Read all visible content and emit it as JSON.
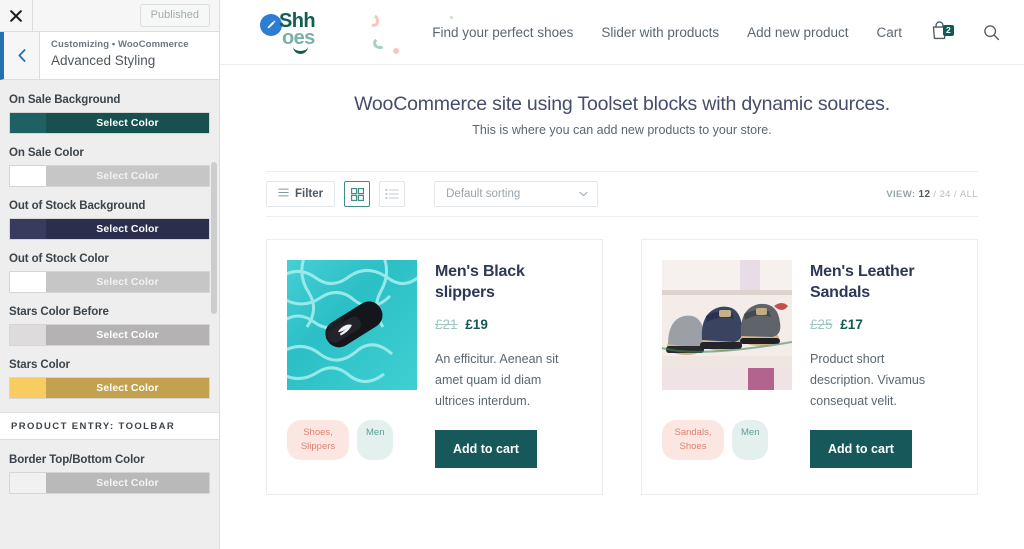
{
  "customizer": {
    "close_icon": "close-icon",
    "published_label": "Published",
    "back_icon": "chevron-left-icon",
    "breadcrumb": "Customizing • WooCommerce",
    "panel_title": "Advanced Styling",
    "controls": [
      {
        "label": "On Sale Background",
        "button_label": "Select Color",
        "chip_color": "#1e6063",
        "button_color": "#16504f",
        "button_text_color": "#ffffff"
      },
      {
        "label": "On Sale Color",
        "button_label": "Select Color",
        "chip_color": "#ffffff",
        "button_color": "#c6c6c6",
        "button_text_color": "#f2f2f2"
      },
      {
        "label": "Out of Stock Background",
        "button_label": "Select Color",
        "chip_color": "#373c5e",
        "button_color": "#2b2e4d",
        "button_text_color": "#ffffff"
      },
      {
        "label": "Out of Stock Color",
        "button_label": "Select Color",
        "chip_color": "#ffffff",
        "button_color": "#c6c6c6",
        "button_text_color": "#f2f2f2"
      },
      {
        "label": "Stars Color Before",
        "button_label": "Select Color",
        "chip_color": "#dddbdb",
        "button_color": "#b4b2b2",
        "button_text_color": "#ffffff"
      },
      {
        "label": "Stars Color",
        "button_label": "Select Color",
        "chip_color": "#f8cc61",
        "button_color": "#c3a14e",
        "button_text_color": "#ffffff"
      }
    ],
    "section_heading": "PRODUCT ENTRY: TOOLBAR",
    "controls_after": [
      {
        "label": "Border Top/Bottom Color",
        "button_label": "Select Color",
        "chip_color": "#f1f1f1",
        "button_color": "#b9b9b9",
        "button_text_color": "#f4f4f4"
      }
    ]
  },
  "site": {
    "logo": {
      "mark_icon": "pencil-circle-icon",
      "text_top": "Shh",
      "text_bottom": "oes"
    },
    "nav": [
      {
        "label": "Find your perfect shoes"
      },
      {
        "label": "Slider with products"
      },
      {
        "label": "Add new product"
      },
      {
        "label": "Cart"
      }
    ],
    "cart": {
      "icon": "shopping-bag-icon",
      "count": "2",
      "badge_color": "#0f5c56"
    },
    "search_icon": "search-icon",
    "page_title": "WooCommerce site using Toolset blocks with dynamic sources.",
    "page_subtitle": "This is where you can add new products to your store."
  },
  "toolbar": {
    "filter_label": "Filter",
    "filter_icon": "hamburger-icon",
    "grid_view_icon": "grid-view-icon",
    "list_view_icon": "list-view-icon",
    "active_view": "grid",
    "sorting_value": "Default sorting",
    "sorting_caret_icon": "chevron-down-icon",
    "view_label": "VIEW:",
    "view_options": [
      "12",
      "24",
      "ALL"
    ],
    "view_selected": "12",
    "view_separator": "/"
  },
  "products": [
    {
      "title": "Men's Black slippers",
      "price_old": "£21",
      "price_new": "£19",
      "description": "An efficitur. Aenean sit amet quam id diam ultrices interdum.",
      "tags": [
        {
          "label": "Shoes, Slippers",
          "kind": "category"
        },
        {
          "label": "Men",
          "kind": "type"
        }
      ],
      "add_to_cart_label": "Add to cart",
      "image_alt": "black-slide-sandal-on-turquoise-water"
    },
    {
      "title": "Men's Leather Sandals",
      "price_old": "£25",
      "price_new": "£17",
      "description": "Product short description. Vivamus consequat velit.",
      "tags": [
        {
          "label": "Sandals, Shoes",
          "kind": "category"
        },
        {
          "label": "Men",
          "kind": "type"
        }
      ],
      "add_to_cart_label": "Add to cart",
      "image_alt": "row-of-leather-sandals-on-shelf"
    }
  ]
}
